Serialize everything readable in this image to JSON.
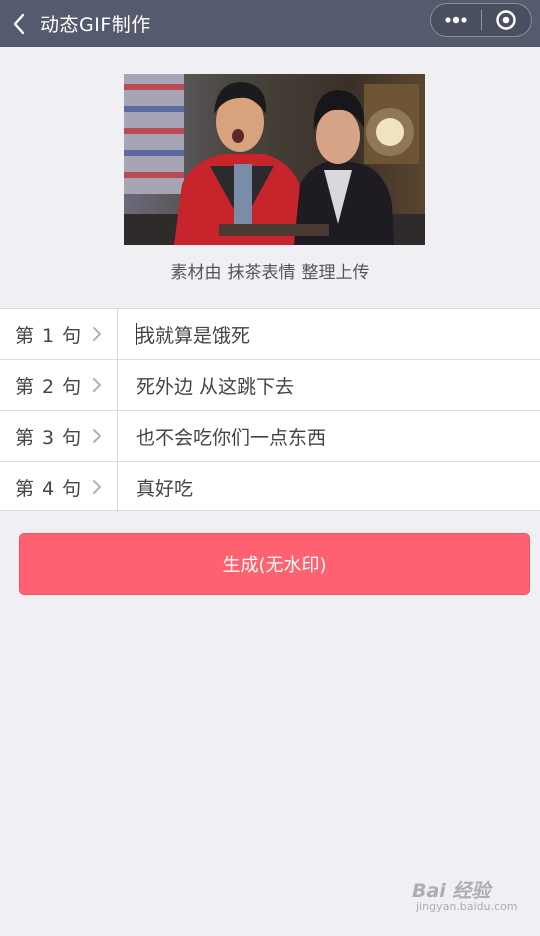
{
  "header": {
    "title": "动态GIF制作",
    "back_icon": "chevron-left-icon",
    "more_icon": "more-dots-icon",
    "close_icon": "target-close-icon"
  },
  "preview": {
    "credit_prefix": "素材由",
    "credit_author": "抹茶表情",
    "credit_suffix": "整理上传"
  },
  "sentences": [
    {
      "label": "第 1 句",
      "value": "我就算是饿死"
    },
    {
      "label": "第 2 句",
      "value": "死外边 从这跳下去"
    },
    {
      "label": "第 3 句",
      "value": "也不会吃你们一点东西"
    },
    {
      "label": "第 4 句",
      "value": "真好吃"
    }
  ],
  "generate_button": {
    "label": "生成(无水印)"
  },
  "watermark": {
    "text": "Bai 经验",
    "sub": "jingyan.baidu.com"
  },
  "colors": {
    "navbar": "#555b6e",
    "background": "#efeff4",
    "button": "#fe616f"
  }
}
